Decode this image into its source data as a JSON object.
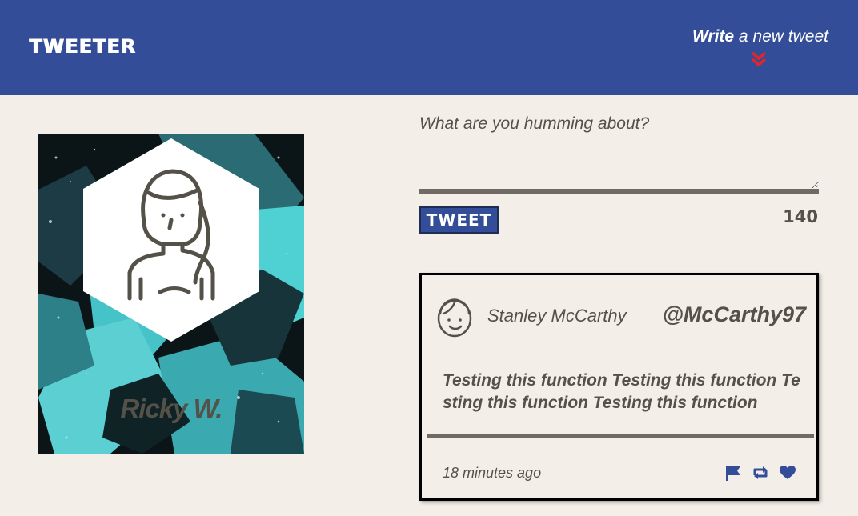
{
  "header": {
    "brand": "TWEETER",
    "compose_toggle": {
      "bold": "Write",
      "rest": " a new tweet"
    },
    "toggle_icon": "double-chevron-down-icon"
  },
  "profile": {
    "name": "Ricky W.",
    "avatar_icon": "girl-avatar-icon"
  },
  "compose": {
    "placeholder": "What are you humming about?",
    "value": "",
    "button_label": "TWEET",
    "char_count": "140"
  },
  "tweets": [
    {
      "author": "Stanley McCarthy",
      "handle": "@McCarthy97",
      "body": "Testing this function Testing this function Testing this function Testing this function",
      "time": "18 minutes ago",
      "actions": [
        "flag-icon",
        "retweet-icon",
        "heart-icon"
      ]
    }
  ],
  "colors": {
    "header_bg": "#334d98",
    "page_bg": "#f3efe8",
    "text": "#545149",
    "chevron": "#e0262a"
  }
}
